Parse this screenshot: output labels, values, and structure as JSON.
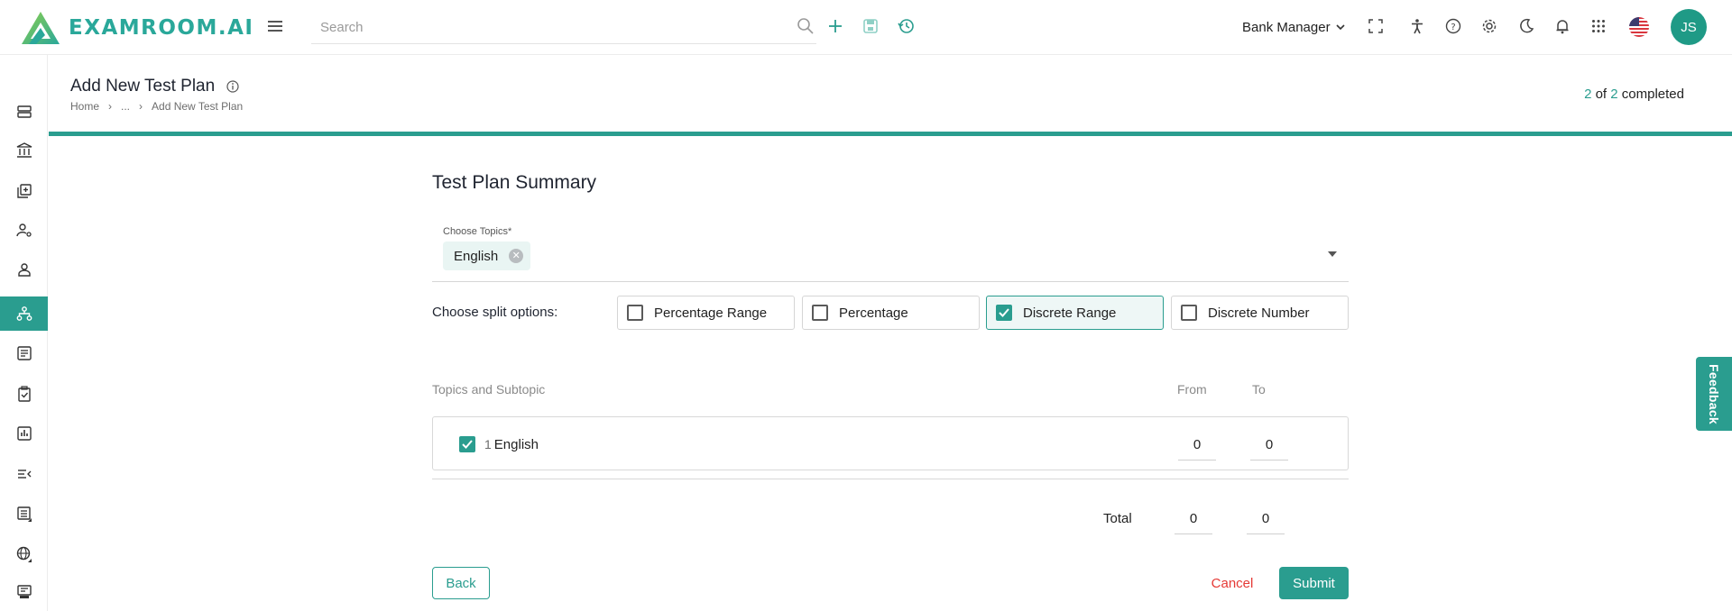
{
  "app": {
    "brand": "EXAMROOM.AI",
    "colors": {
      "accent": "#2a9d8f",
      "danger": "#e53935",
      "avatar": "#1f9a86"
    }
  },
  "header": {
    "search_placeholder": "Search",
    "role": "Bank Manager",
    "avatar_initials": "JS",
    "icons": [
      "menu-icon",
      "search-icon",
      "plus-icon",
      "save-icon",
      "history-icon",
      "fullscreen-icon",
      "accessibility-icon",
      "help-icon",
      "settings-icon",
      "dark-mode-icon",
      "notification-bell-icon",
      "apps-grid-icon",
      "us-flag-icon"
    ]
  },
  "sidebar": {
    "items": [
      {
        "icon": "servers-icon"
      },
      {
        "icon": "bank-icon"
      },
      {
        "icon": "add-library-icon"
      },
      {
        "icon": "user-settings-icon"
      },
      {
        "icon": "user-icon"
      },
      {
        "icon": "hierarchy-icon",
        "active": true
      },
      {
        "icon": "checklist-icon"
      },
      {
        "icon": "clipboard-check-icon"
      },
      {
        "icon": "bar-chart-icon"
      },
      {
        "icon": "menu-collapse-icon"
      },
      {
        "icon": "list-icon"
      },
      {
        "icon": "globe-settings-icon"
      },
      {
        "icon": "certificate-icon"
      }
    ]
  },
  "page": {
    "title": "Add New Test Plan",
    "breadcrumb": [
      "Home",
      "...",
      "Add New Test Plan"
    ],
    "progress": {
      "current": "2",
      "of_word": "of",
      "total": "2",
      "suffix": "completed",
      "fraction": 1.0
    }
  },
  "form": {
    "section_title": "Test Plan Summary",
    "topics_label": "Choose Topics*",
    "selected_topics": [
      "English"
    ],
    "split_label": "Choose split options:",
    "split_options": [
      {
        "label": "Percentage Range",
        "checked": false
      },
      {
        "label": "Percentage",
        "checked": false
      },
      {
        "label": "Discrete Range",
        "checked": true
      },
      {
        "label": "Discrete Number",
        "checked": false
      }
    ],
    "table": {
      "col_topic": "Topics and Subtopic",
      "col_from": "From",
      "col_to": "To",
      "rows": [
        {
          "index": "1",
          "name": "English",
          "checked": true,
          "from": "0",
          "to": "0"
        }
      ]
    },
    "total": {
      "label": "Total",
      "from": "0",
      "to": "0"
    }
  },
  "actions": {
    "back": "Back",
    "cancel": "Cancel",
    "submit": "Submit"
  },
  "feedback": "Feedback"
}
